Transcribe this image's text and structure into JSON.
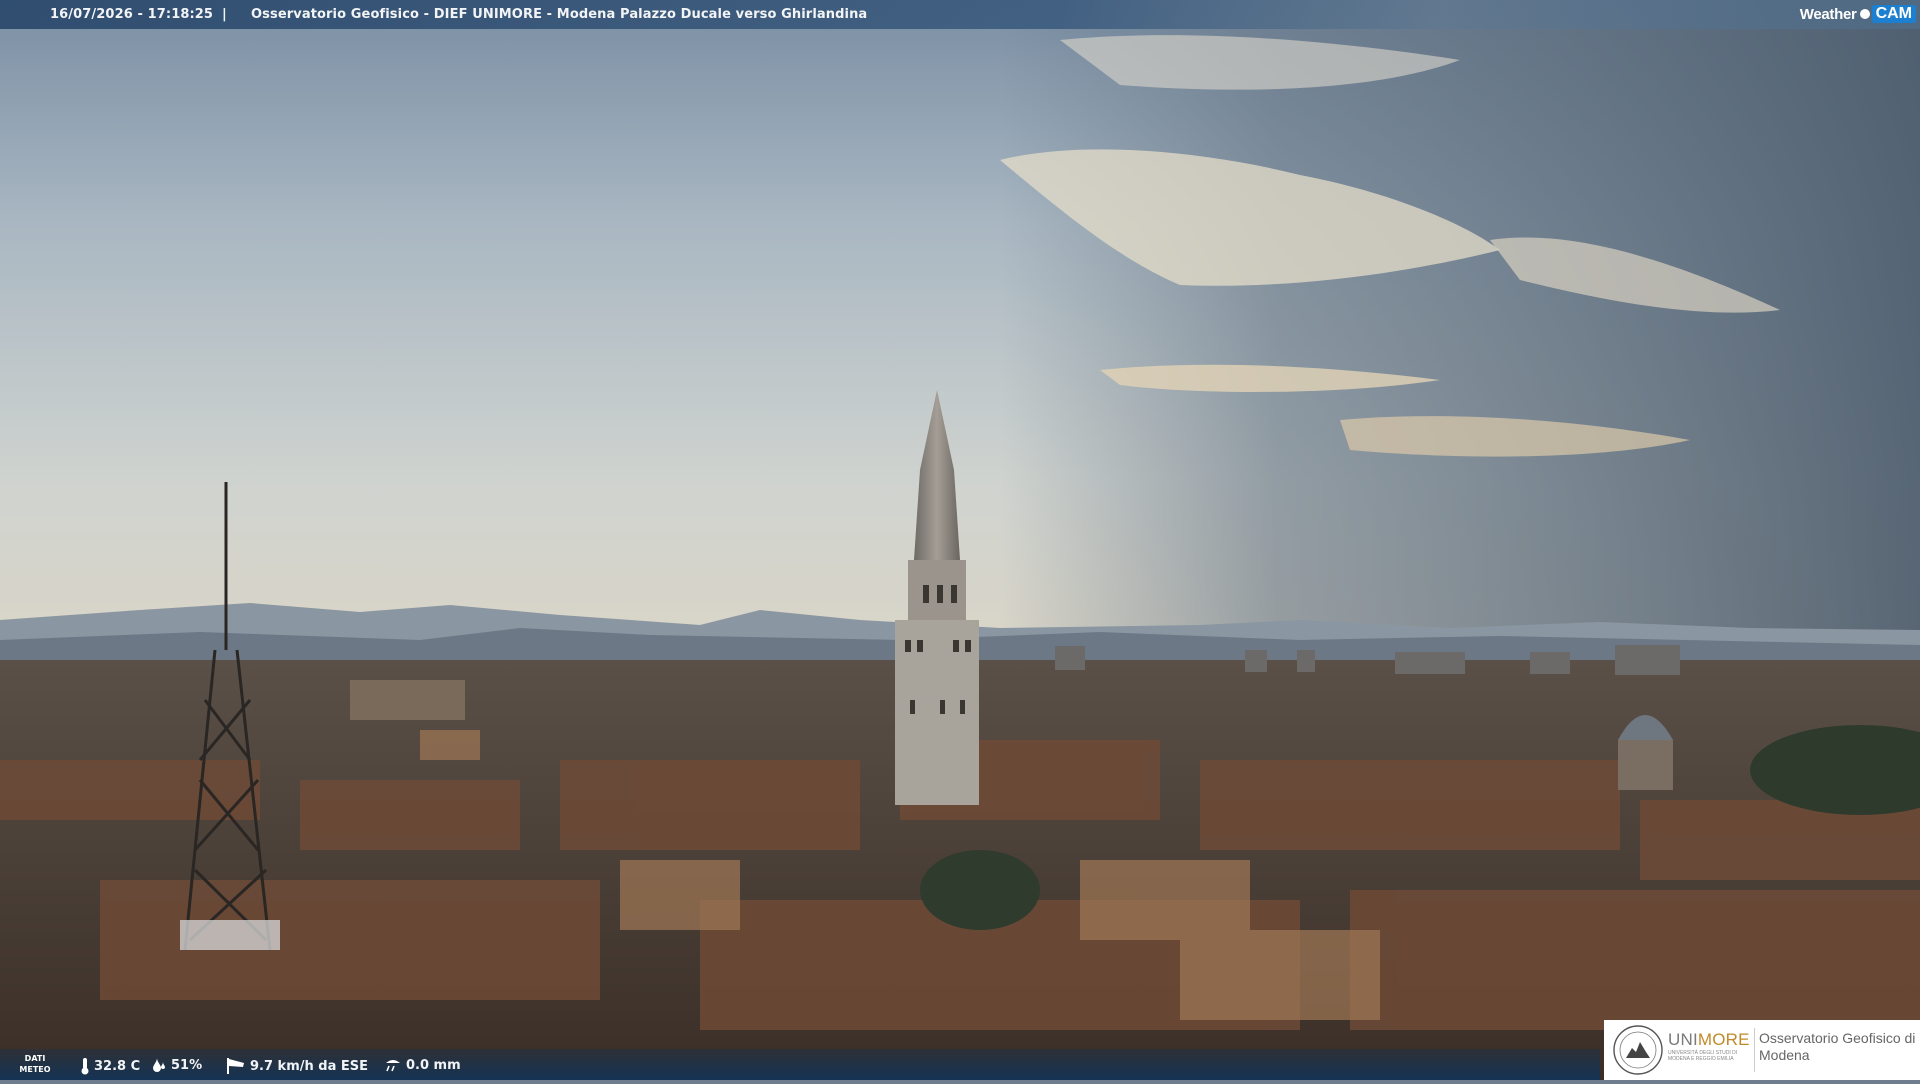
{
  "header": {
    "timestamp": "16/07/2026 - 17:18:25",
    "separator": "|",
    "title": "Osservatorio Geofisico - DIEF UNIMORE - Modena Palazzo Ducale verso Ghirlandina",
    "logo_weather": "Weather",
    "logo_cam": "CAM"
  },
  "meteo": {
    "label": "DATI METEO",
    "temperature": "32.8 C",
    "humidity": "51%",
    "wind": "9.7 km/h da ESE",
    "rain": "0.0 mm",
    "icons": [
      "thermometer-icon",
      "humidity-drop-icon",
      "wind-sock-icon",
      "rain-gauge-icon"
    ]
  },
  "branding": {
    "university_prefix": "UNI",
    "university_suffix": "MORE",
    "university_sub": "UNIVERSITÀ DEGLI STUDI DI MODENA E REGGIO EMILIA",
    "observatory": "Osservatorio Geofisico di Modena"
  },
  "colors": {
    "bar": "#2a486c",
    "unimore_accent": "#c08a2a",
    "cam_blue": "#1d7fd0"
  }
}
